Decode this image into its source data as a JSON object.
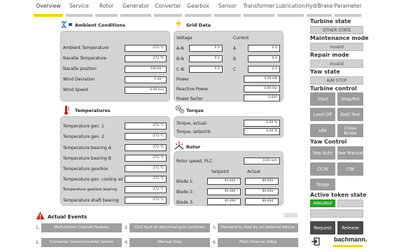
{
  "nav": {
    "tabs": [
      "Overview",
      "Service",
      "Rotor",
      "Generator",
      "Converter",
      "Gearbox",
      "Sensor",
      "Transformer",
      "Lubrication",
      "Hyd/Brake",
      "Parameter"
    ],
    "active": 0
  },
  "ambient": {
    "title": "Ambient Conditions",
    "rows": [
      {
        "label": "Ambient Temperature",
        "value": "-273 °C"
      },
      {
        "label": "Nacelle Temperature",
        "value": "-273 °C"
      },
      {
        "label": "Nacelle position",
        "value": "338.00 °"
      },
      {
        "label": "Wind Deviation",
        "value": "0.00 °"
      },
      {
        "label": "Wind Speed",
        "value": "0.00 m/s"
      }
    ]
  },
  "grid": {
    "title": "Grid Data",
    "voltage_header": "Voltage",
    "current_header": "Current",
    "rows": [
      {
        "vlabel": "A-N",
        "v": "0 V",
        "clabel": "A",
        "c": "0 A"
      },
      {
        "vlabel": "B-N",
        "v": "0 V",
        "clabel": "B",
        "c": "0 A"
      },
      {
        "vlabel": "C-N",
        "v": "0 V",
        "clabel": "C",
        "c": "0 A"
      }
    ],
    "power_label": "Power",
    "power": "0.00 kW",
    "reactive_label": "Reactive Power",
    "reactive": "0.00 Var",
    "pf_label": "Power factor",
    "pf": "0.000"
  },
  "temperatures": {
    "title": "Temperatures",
    "rows": [
      {
        "label": "Temperature gen. 1",
        "value": "-273 °C"
      },
      {
        "label": "Temperature gen. 2",
        "value": "-273 °C"
      },
      {
        "label": "Temperature bearing A",
        "value": "-273 °C"
      },
      {
        "label": "Temperature bearing B",
        "value": "-273 °C"
      },
      {
        "label": "Temperature gearbox",
        "value": "-273 °C"
      },
      {
        "label": "Temperature gen. cooling air",
        "value": "-273 °C"
      },
      {
        "label": "Temperature gearbox bearing",
        "value": "-273 °C"
      },
      {
        "label": "Temperature shaft bearing",
        "value": "-273 °C"
      }
    ]
  },
  "torque": {
    "title": "Torque",
    "actual_label": "Torque, actual:",
    "actual": "0.00 %",
    "setpoint_label": "Torque, setpoint:",
    "setpoint": "0.00 %"
  },
  "rotor": {
    "title": "Rotor",
    "speed_label": "Rotor speed, PLC:",
    "speed": "0.00 rpm",
    "setpoint_header": "Setpoint",
    "actual_header": "Actual",
    "blades": [
      {
        "label": "Blade 1:",
        "setpoint": "95.000 °",
        "actual": "89.600 °"
      },
      {
        "label": "Blade 2:",
        "setpoint": "95.000 °",
        "actual": "89.600 °"
      },
      {
        "label": "Blade 3:",
        "setpoint": "95.000 °",
        "actual": "89.600 °"
      }
    ]
  },
  "right": {
    "turbine_state_title": "Turbine state",
    "turbine_state": "OTHER STATE",
    "maintenance_title": "Maintenance mode",
    "maintenance": "invalid",
    "repair_title": "Repair mode",
    "repair": "invalid",
    "yaw_state_title": "Yaw state",
    "yaw_state": "A/M STOP",
    "turbine_control_title": "Turbine control",
    "control_buttons": [
      "Start",
      "Stop/Rst",
      "Load Off",
      "Batt Test",
      "Idle",
      "Close Brake"
    ],
    "yaw_control_title": "Yaw Control",
    "yaw_buttons": [
      "Yaw Auto",
      "Yaw Manual",
      "CCW",
      "CW",
      "Stopp"
    ],
    "token_title": "Active token state",
    "token_status": "AVAILABLE",
    "request_label": "Request",
    "release_label": "Release",
    "brand": "bachmann."
  },
  "events": {
    "title": "Actual Events",
    "items": [
      {
        "num": "1.",
        "text": "Malfunction Cabinet Heaters"
      },
      {
        "num": "3.",
        "text": "CCU fault at abnormal grid condition"
      },
      {
        "num": "5.",
        "text": "Demand to stop by an external device"
      },
      {
        "num": "2.",
        "text": "Converter communication failure"
      },
      {
        "num": "4.",
        "text": "Manual Stop"
      },
      {
        "num": "6.",
        "text": "Pitch Overrun 0deg"
      }
    ]
  },
  "colors": {
    "accent": "#f0d500",
    "available": "#2aa52a",
    "button": "#9b9b9b",
    "dark_button": "#4a4a4a",
    "panel": "#d4d4d4"
  }
}
